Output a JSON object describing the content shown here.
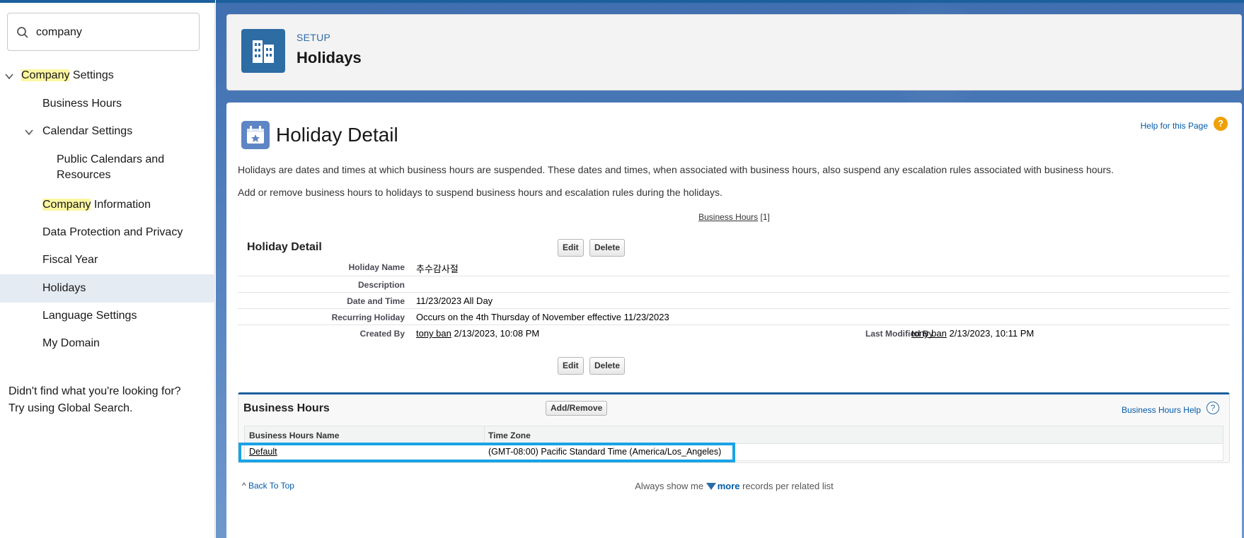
{
  "search": {
    "value": "company"
  },
  "sidebar": {
    "company_settings": {
      "hl": "Company",
      "rest": " Settings"
    },
    "items": {
      "business_hours": "Business Hours",
      "calendar_settings": "Calendar Settings",
      "public_calendars_1": "Public Calendars and",
      "public_calendars_2": "Resources",
      "company_information_hl": "Company",
      "company_information_rest": " Information",
      "data_protection": "Data Protection and Privacy",
      "fiscal_year": "Fiscal Year",
      "holidays": "Holidays",
      "language_settings": "Language Settings",
      "my_domain": "My Domain"
    },
    "not_found_1": "Didn't find what you're looking for?",
    "not_found_2": "Try using Global Search."
  },
  "header": {
    "setup": "SETUP",
    "title": "Holidays"
  },
  "detail": {
    "page_title": "Holiday Detail",
    "help_link": "Help for this Page",
    "help_icon": "?",
    "para1": "Holidays are dates and times at which business hours are suspended. These dates and times, when associated with business hours, also suspend any escalation rules associated with business hours.",
    "para2": "Add or remove business hours to holidays to suspend business hours and escalation rules during the holidays.",
    "related_link": "Business Hours",
    "related_count": "[1]",
    "section_title": "Holiday Detail",
    "edit_label": "Edit",
    "delete_label": "Delete",
    "fields": {
      "holiday_name_label": "Holiday Name",
      "holiday_name": "추수감사절",
      "description_label": "Description",
      "description": "",
      "date_time_label": "Date and Time",
      "date_time": "11/23/2023 All Day",
      "recurring_label": "Recurring Holiday",
      "recurring": "Occurs on the 4th Thursday of November effective 11/23/2023",
      "created_by_label": "Created By",
      "created_by_user": "tony ban",
      "created_by_date": " 2/13/2023, 10:08 PM",
      "last_modified_label": "Last Modified By",
      "last_modified_user": "tony ban",
      "last_modified_date": " 2/13/2023, 10:11 PM"
    }
  },
  "business_hours": {
    "title": "Business Hours",
    "add_remove": "Add/Remove",
    "help_link": "Business Hours Help",
    "help_icon": "?",
    "columns": [
      "Business Hours Name",
      "Time Zone"
    ],
    "rows": [
      {
        "name": "Default",
        "tz": "(GMT-08:00) Pacific Standard Time (America/Los_Angeles)"
      }
    ]
  },
  "footer": {
    "back_to_top": "Back To Top",
    "always_prefix": "Always show me ",
    "more": "more",
    "always_suffix": " records per related list"
  }
}
